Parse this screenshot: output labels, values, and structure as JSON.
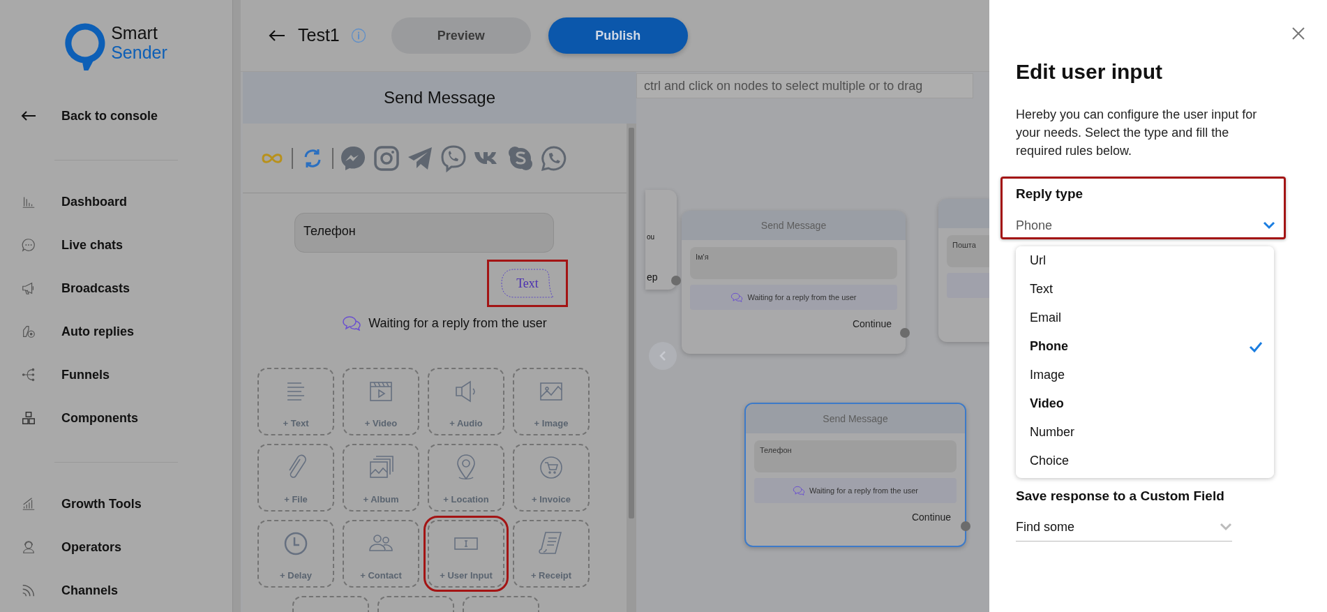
{
  "sidebar": {
    "logo": {
      "line_1": "Smart",
      "line_2": "Sender"
    },
    "back_link": "Back to console",
    "groups": [
      [
        "Dashboard",
        "Live chats",
        "Broadcasts",
        "Auto replies",
        "Funnels",
        "Components"
      ],
      [
        "Growth Tools",
        "Operators",
        "Channels"
      ]
    ]
  },
  "header": {
    "title": "Test1",
    "buttons": [
      {
        "label": "Preview",
        "kind": "secondary"
      },
      {
        "label": "Publish",
        "kind": "primary"
      }
    ]
  },
  "editor": {
    "title": "Send Message",
    "message": "Телефон",
    "reply_bubble": {
      "label": "Text",
      "highlighted": true
    },
    "waiting": "Waiting for a reply from the user",
    "blocks": [
      {
        "label": "+ Text",
        "highlighted": false
      },
      {
        "label": "+ Video",
        "highlighted": false
      },
      {
        "label": "+ Audio",
        "highlighted": false
      },
      {
        "label": "+ Image",
        "highlighted": false
      },
      {
        "label": "+ File",
        "highlighted": false
      },
      {
        "label": "+ Album",
        "highlighted": false
      },
      {
        "label": "+ Location",
        "highlighted": false
      },
      {
        "label": "+ Invoice",
        "highlighted": false
      },
      {
        "label": "+ Delay",
        "highlighted": false
      },
      {
        "label": "+ Contact",
        "highlighted": false
      },
      {
        "label": "+ User Input",
        "highlighted": true
      },
      {
        "label": "+ Receipt",
        "highlighted": false
      }
    ]
  },
  "canvas": {
    "hint": "ctrl and click on nodes to select multiple or to drag",
    "nodes": [
      {
        "kind": "partial_left",
        "lines": [
          "ou",
          "ep"
        ]
      },
      {
        "kind": "node",
        "title": "Send Message",
        "message": "Ім'я",
        "waiting": "Waiting for a reply from the user",
        "continue": "Continue",
        "selected": false
      },
      {
        "kind": "partial_right",
        "message": "Пошта"
      },
      {
        "kind": "node",
        "title": "Send Message",
        "message": "Телефон",
        "waiting": "Waiting for a reply from the user",
        "continue": "Continue",
        "selected": true
      }
    ]
  },
  "panel": {
    "title": "Edit user input",
    "description": "Hereby you can configure the user input for your needs. Select the type and fill the required rules below.",
    "reply_type": {
      "label": "Reply type",
      "value": "Phone",
      "highlighted": true,
      "expanded": true,
      "options": [
        {
          "label": "Url",
          "selected": false,
          "hovered": false
        },
        {
          "label": "Text",
          "selected": false,
          "hovered": false
        },
        {
          "label": "Email",
          "selected": false,
          "hovered": false
        },
        {
          "label": "Phone",
          "selected": true,
          "hovered": false
        },
        {
          "label": "Image",
          "selected": false,
          "hovered": false
        },
        {
          "label": "Video",
          "selected": false,
          "hovered": true
        },
        {
          "label": "Number",
          "selected": false,
          "hovered": false
        },
        {
          "label": "Choice",
          "selected": false,
          "hovered": false
        }
      ]
    },
    "custom_field": {
      "label": "Save response to a Custom Field",
      "placeholder": "Find some"
    }
  }
}
